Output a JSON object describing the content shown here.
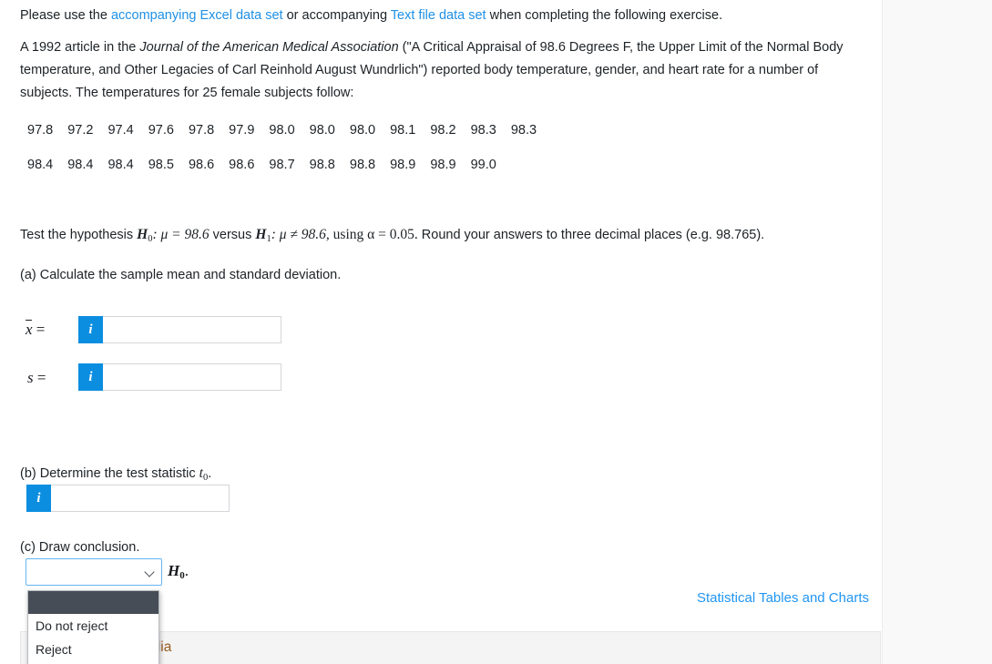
{
  "intro": {
    "prefix": "Please use the ",
    "link1": "accompanying Excel data set",
    "middle": " or accompanying ",
    "link2": "Text file data set",
    "suffix": " when completing the following exercise."
  },
  "problem": {
    "part1": "A 1992 article in the ",
    "journal": "Journal of the American Medical Association",
    "part2": " (\"A Critical Appraisal of 98.6 Degrees F, the Upper Limit of the Normal Body temperature, and Other Legacies of Carl Reinhold August Wundrlich\") reported body temperature, gender, and heart rate for a number of subjects. The temperatures for 25 female subjects follow:"
  },
  "data_rows": [
    [
      "97.8",
      "97.2",
      "97.4",
      "97.6",
      "97.8",
      "97.9",
      "98.0",
      "98.0",
      "98.0",
      "98.1",
      "98.2",
      "98.3",
      "98.3"
    ],
    [
      "98.4",
      "98.4",
      "98.4",
      "98.5",
      "98.6",
      "98.6",
      "98.7",
      "98.8",
      "98.8",
      "98.9",
      "98.9",
      "99.0"
    ]
  ],
  "hypothesis": {
    "lead": "Test the hypothesis ",
    "h0": "H",
    "h0_sub": "0",
    "h0_rest": ": μ = 98.6",
    "versus": " versus ",
    "h1": "H",
    "h1_sub": "1",
    "h1_rest": ": μ ≠ 98.6,",
    "alpha": " using α = 0.05.",
    "tail": " Round your answers to three decimal places (e.g. 98.765)."
  },
  "part_a": {
    "prompt": "(a) Calculate the sample mean and standard deviation.",
    "xbar_label_x": "x",
    "xbar_label_eq": " =",
    "s_label": "s",
    "s_label_eq": " =",
    "info_glyph": "i",
    "xbar_value": "",
    "xbar_placeholder": "",
    "s_value": "",
    "s_placeholder": ""
  },
  "part_b": {
    "prompt_lead": "(b) Determine the test statistic ",
    "prompt_t": "t",
    "prompt_sub": "0",
    "prompt_end": ".",
    "info_glyph": "i",
    "value": "",
    "placeholder": ""
  },
  "part_c": {
    "prompt": "(c) Draw conclusion.",
    "selected_value": "",
    "options": [
      "",
      "Do not reject",
      "Reject"
    ],
    "chevron": "chevron-down-icon",
    "h0": "H",
    "h0_sub": "0",
    "h0_dot": "."
  },
  "stat_tables_link": "Statistical Tables and Charts",
  "media_panel": {
    "title": "eTextbook and Media"
  },
  "colors": {
    "link_blue": "#1f90e5",
    "accent_blue": "#0b8ee0",
    "select_border": "#64b5f0",
    "option_highlight": "#464d57",
    "media_title": "#9a5b20"
  }
}
